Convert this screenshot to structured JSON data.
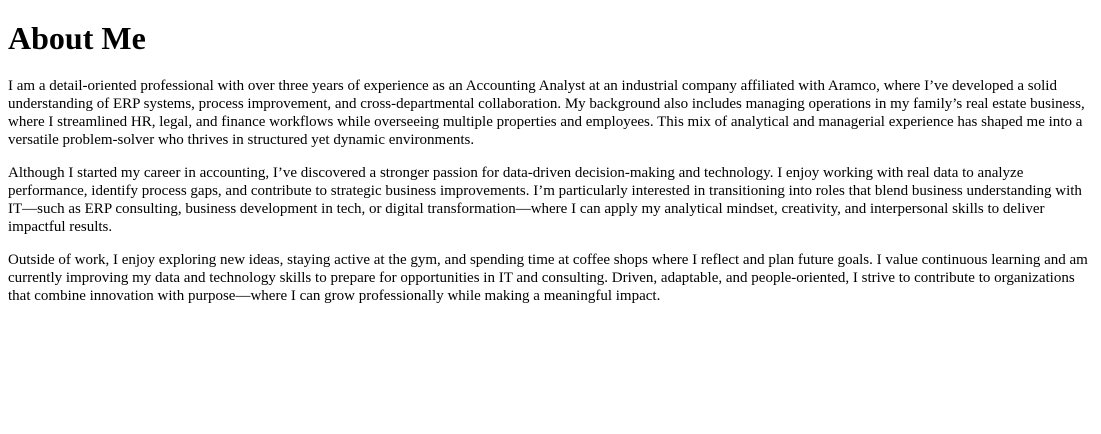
{
  "page": {
    "heading": "About Me",
    "paragraphs": [
      "I am a detail-oriented professional with over three years of experience as an Accounting Analyst at an industrial company affiliated with Aramco, where I’ve developed a solid understanding of ERP systems, process improvement, and cross-departmental collaboration. My background also includes managing operations in my family’s real estate business, where I streamlined HR, legal, and finance workflows while overseeing multiple properties and employees. This mix of analytical and managerial experience has shaped me into a versatile problem-solver who thrives in structured yet dynamic environments.",
      "Although I started my career in accounting, I’ve discovered a stronger passion for data-driven decision-making and technology. I enjoy working with real data to analyze performance, identify process gaps, and contribute to strategic business improvements. I’m particularly interested in transitioning into roles that blend business understanding with IT—such as ERP consulting, business development in tech, or digital transformation—where I can apply my analytical mindset, creativity, and interpersonal skills to deliver impactful results.",
      "Outside of work, I enjoy exploring new ideas, staying active at the gym, and spending time at coffee shops where I reflect and plan future goals. I value continuous learning and am currently improving my data and technology skills to prepare for opportunities in IT and consulting. Driven, adaptable, and people-oriented, I strive to contribute to organizations that combine innovation with purpose—where I can grow professionally while making a meaningful impact."
    ]
  }
}
